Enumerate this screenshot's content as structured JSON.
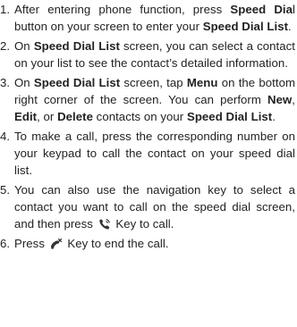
{
  "steps": [
    {
      "num": "1.",
      "parts": [
        "After entering phone function, press ",
        "Speed Dia",
        "l button on your screen to enter your ",
        "Speed Dial List",
        "."
      ]
    },
    {
      "num": "2.",
      "parts": [
        "On ",
        "Speed Dial List",
        " screen, you can select a contact on your list to see the contact’s detailed information."
      ]
    },
    {
      "num": "3.",
      "parts": [
        "On ",
        "Speed Dial List",
        " screen, tap ",
        "Menu",
        " on the bottom right corner of the screen. You can perform ",
        "New",
        ", ",
        "Edit",
        ", or ",
        "Delete",
        " contacts on your ",
        "Speed Dial List",
        "."
      ]
    },
    {
      "num": "4.",
      "parts": [
        "To make a call, press the corresponding number on your keypad to call the contact on your speed dial list."
      ]
    },
    {
      "num": "5.",
      "parts": [
        "You can also use the navigation key to select a contact you want to call on the speed dial screen, and then press ",
        " Key to call."
      ]
    },
    {
      "num": "6.",
      "parts": [
        "Press ",
        " Key to end the call."
      ]
    }
  ],
  "icons": {
    "call_key": "phone-send-icon",
    "end_key": "phone-end-icon",
    "call_color": "#333333",
    "end_color": "#333333"
  }
}
